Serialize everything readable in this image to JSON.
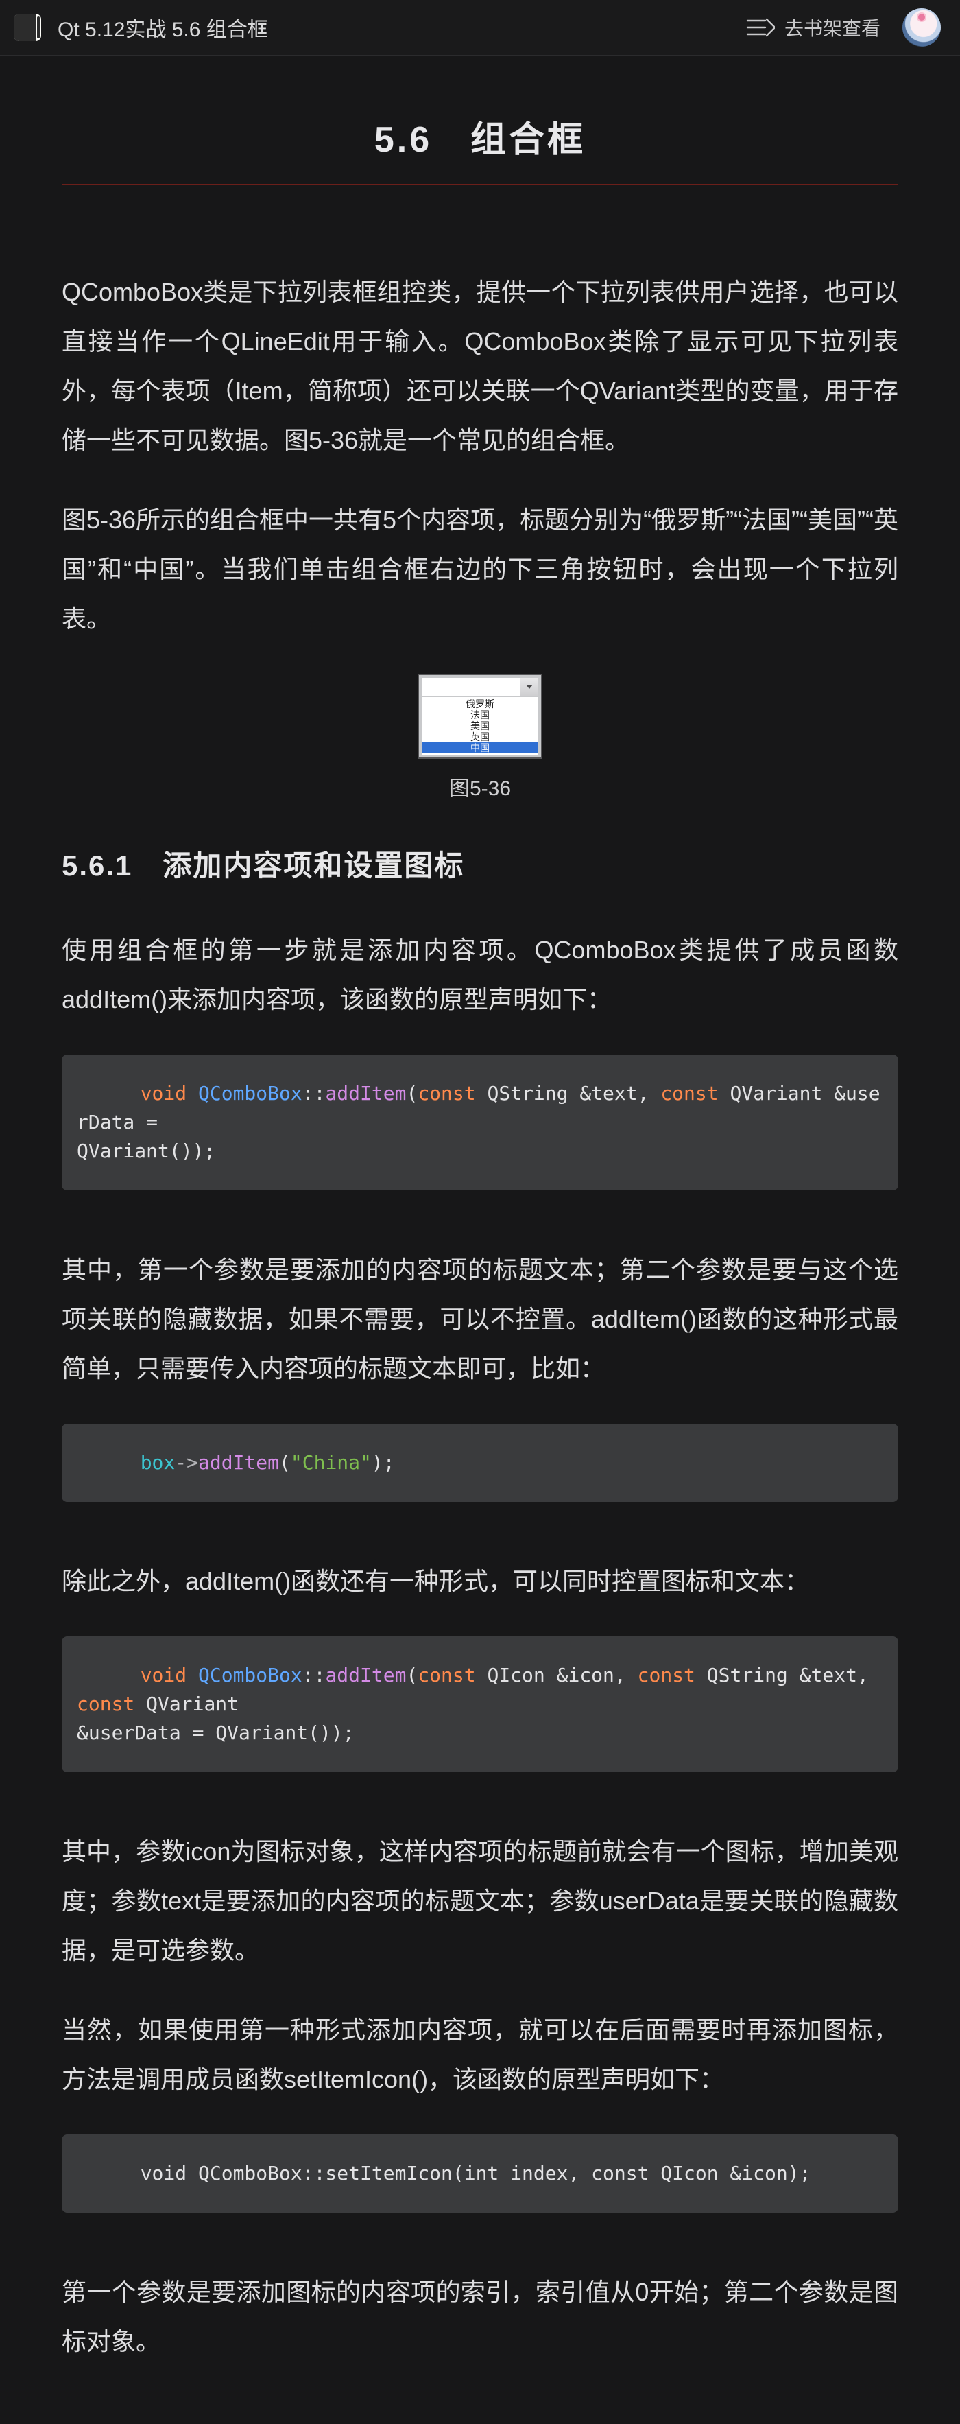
{
  "header": {
    "title": "Qt 5.12实战 5.6 组合框",
    "shelf_label": "去书架查看"
  },
  "main_title": "5.6　组合框",
  "paragraphs": {
    "p1": "QComboBox类是下拉列表框组控类，提供一个下拉列表供用户选择，也可以直接当作一个QLineEdit用于输入。QComboBox类除了显示可见下拉列表外，每个表项（Item，简称项）还可以关联一个QVariant类型的变量，用于存储一些不可见数据。图5-36就是一个常见的组合框。",
    "p2": "图5-36所示的组合框中一共有5个内容项，标题分别为“俄罗斯”“法国”“美国”“英国”和“中国”。当我们单击组合框右边的下三角按钮时，会出现一个下拉列表。",
    "fig_caption": "图5-36",
    "sub1": "5.6.1　添加内容项和设置图标",
    "p3": "使用组合框的第一步就是添加内容项。QComboBox类提供了成员函数addItem()来添加内容项，该函数的原型声明如下：",
    "p4": "其中，第一个参数是要添加的内容项的标题文本；第二个参数是要与这个选项关联的隐藏数据，如果不需要，可以不控置。addItem()函数的这种形式最简单，只需要传入内容项的标题文本即可，比如：",
    "p5": "除此之外，addItem()函数还有一种形式，可以同时控置图标和文本：",
    "p6": "其中，参数icon为图标对象，这样内容项的标题前就会有一个图标，增加美观度；参数text是要添加的内容项的标题文本；参数userData是要关联的隐藏数据，是可选参数。",
    "p7": "当然，如果使用第一种形式添加内容项，就可以在后面需要时再添加图标，方法是调用成员函数setItemIcon()，该函数的原型声明如下：",
    "p8": "第一个参数是要添加图标的内容项的索引，索引值从0开始；第二个参数是图标对象。"
  },
  "figure_items": [
    "俄罗斯",
    "法国",
    "美国",
    "英国",
    "中国"
  ],
  "code": {
    "c1": {
      "void": "void",
      "cls": "QComboBox",
      "scope": "::",
      "fn": "addItem",
      "open": "(",
      "const1": "const",
      "txt1": " QString &text, ",
      "const2": "const",
      "txt2": " QVariant &userData = ",
      "line3": "QVariant());"
    },
    "c2": {
      "obj": "box",
      "arrow": "->",
      "fn": "addItem",
      "open": "(",
      "str": "\"China\"",
      "close": ");"
    },
    "c3": {
      "void": "void",
      "cls": "QComboBox",
      "scope": "::",
      "fn": "addItem",
      "open": "(",
      "const1": "const",
      "txt1": " QIcon &icon, ",
      "const2": "const",
      "txt2": " QString &text, ",
      "const3": "const",
      "txt3": " QVariant ",
      "line3": "&userData = QVariant());"
    },
    "c4": "void QComboBox::setItemIcon(int index, const QIcon &icon);"
  }
}
